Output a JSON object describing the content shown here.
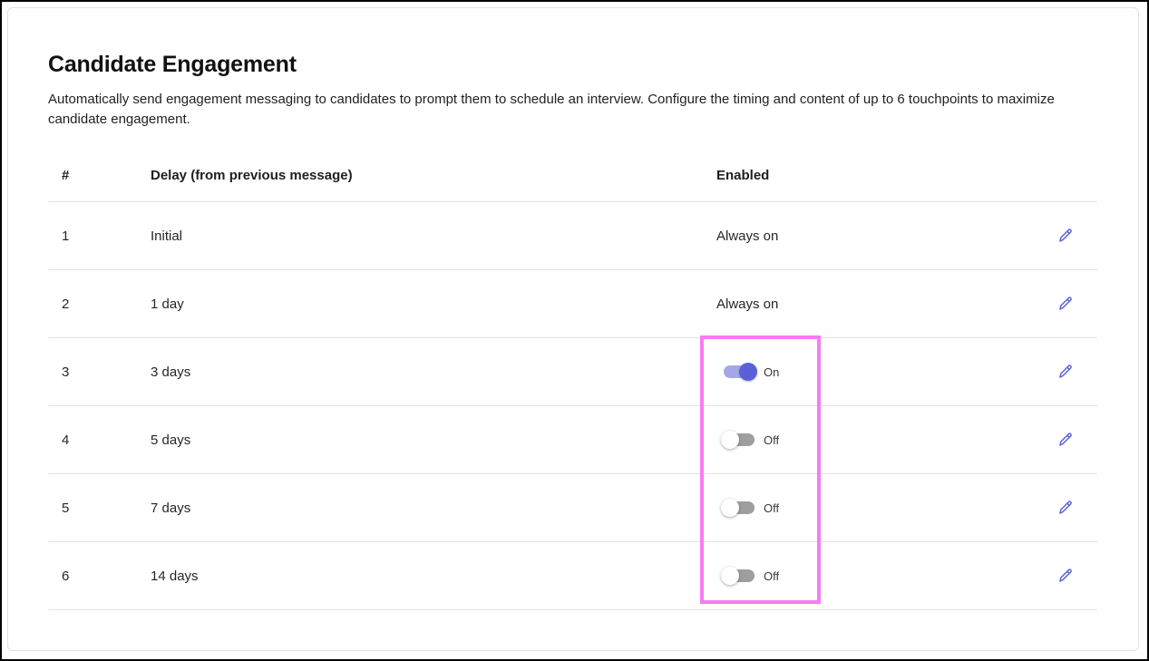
{
  "page": {
    "title": "Candidate Engagement",
    "description": "Automatically send engagement messaging to candidates to prompt them to schedule an interview. Configure the timing and content of up to 6 touchpoints to maximize candidate engagement."
  },
  "table": {
    "headers": {
      "number": "#",
      "delay": "Delay (from previous message)",
      "enabled": "Enabled"
    },
    "rows": [
      {
        "number": "1",
        "delay": "Initial",
        "enabled_text": "Always on"
      },
      {
        "number": "2",
        "delay": "1 day",
        "enabled_text": "Always on"
      },
      {
        "number": "3",
        "delay": "3 days",
        "toggle_label": "On",
        "toggle_state": "on"
      },
      {
        "number": "4",
        "delay": "5 days",
        "toggle_label": "Off",
        "toggle_state": "off"
      },
      {
        "number": "5",
        "delay": "7 days",
        "toggle_label": "Off",
        "toggle_state": "off"
      },
      {
        "number": "6",
        "delay": "14 days",
        "toggle_label": "Off",
        "toggle_state": "off"
      }
    ]
  },
  "colors": {
    "accent": "#5a60d8",
    "accent_light": "#a4a9e6",
    "toggle_off": "#9e9e9e",
    "highlight": "#f77cf2",
    "edit_icon": "#5a60d8"
  },
  "icons": {
    "edit": "pencil-icon"
  }
}
